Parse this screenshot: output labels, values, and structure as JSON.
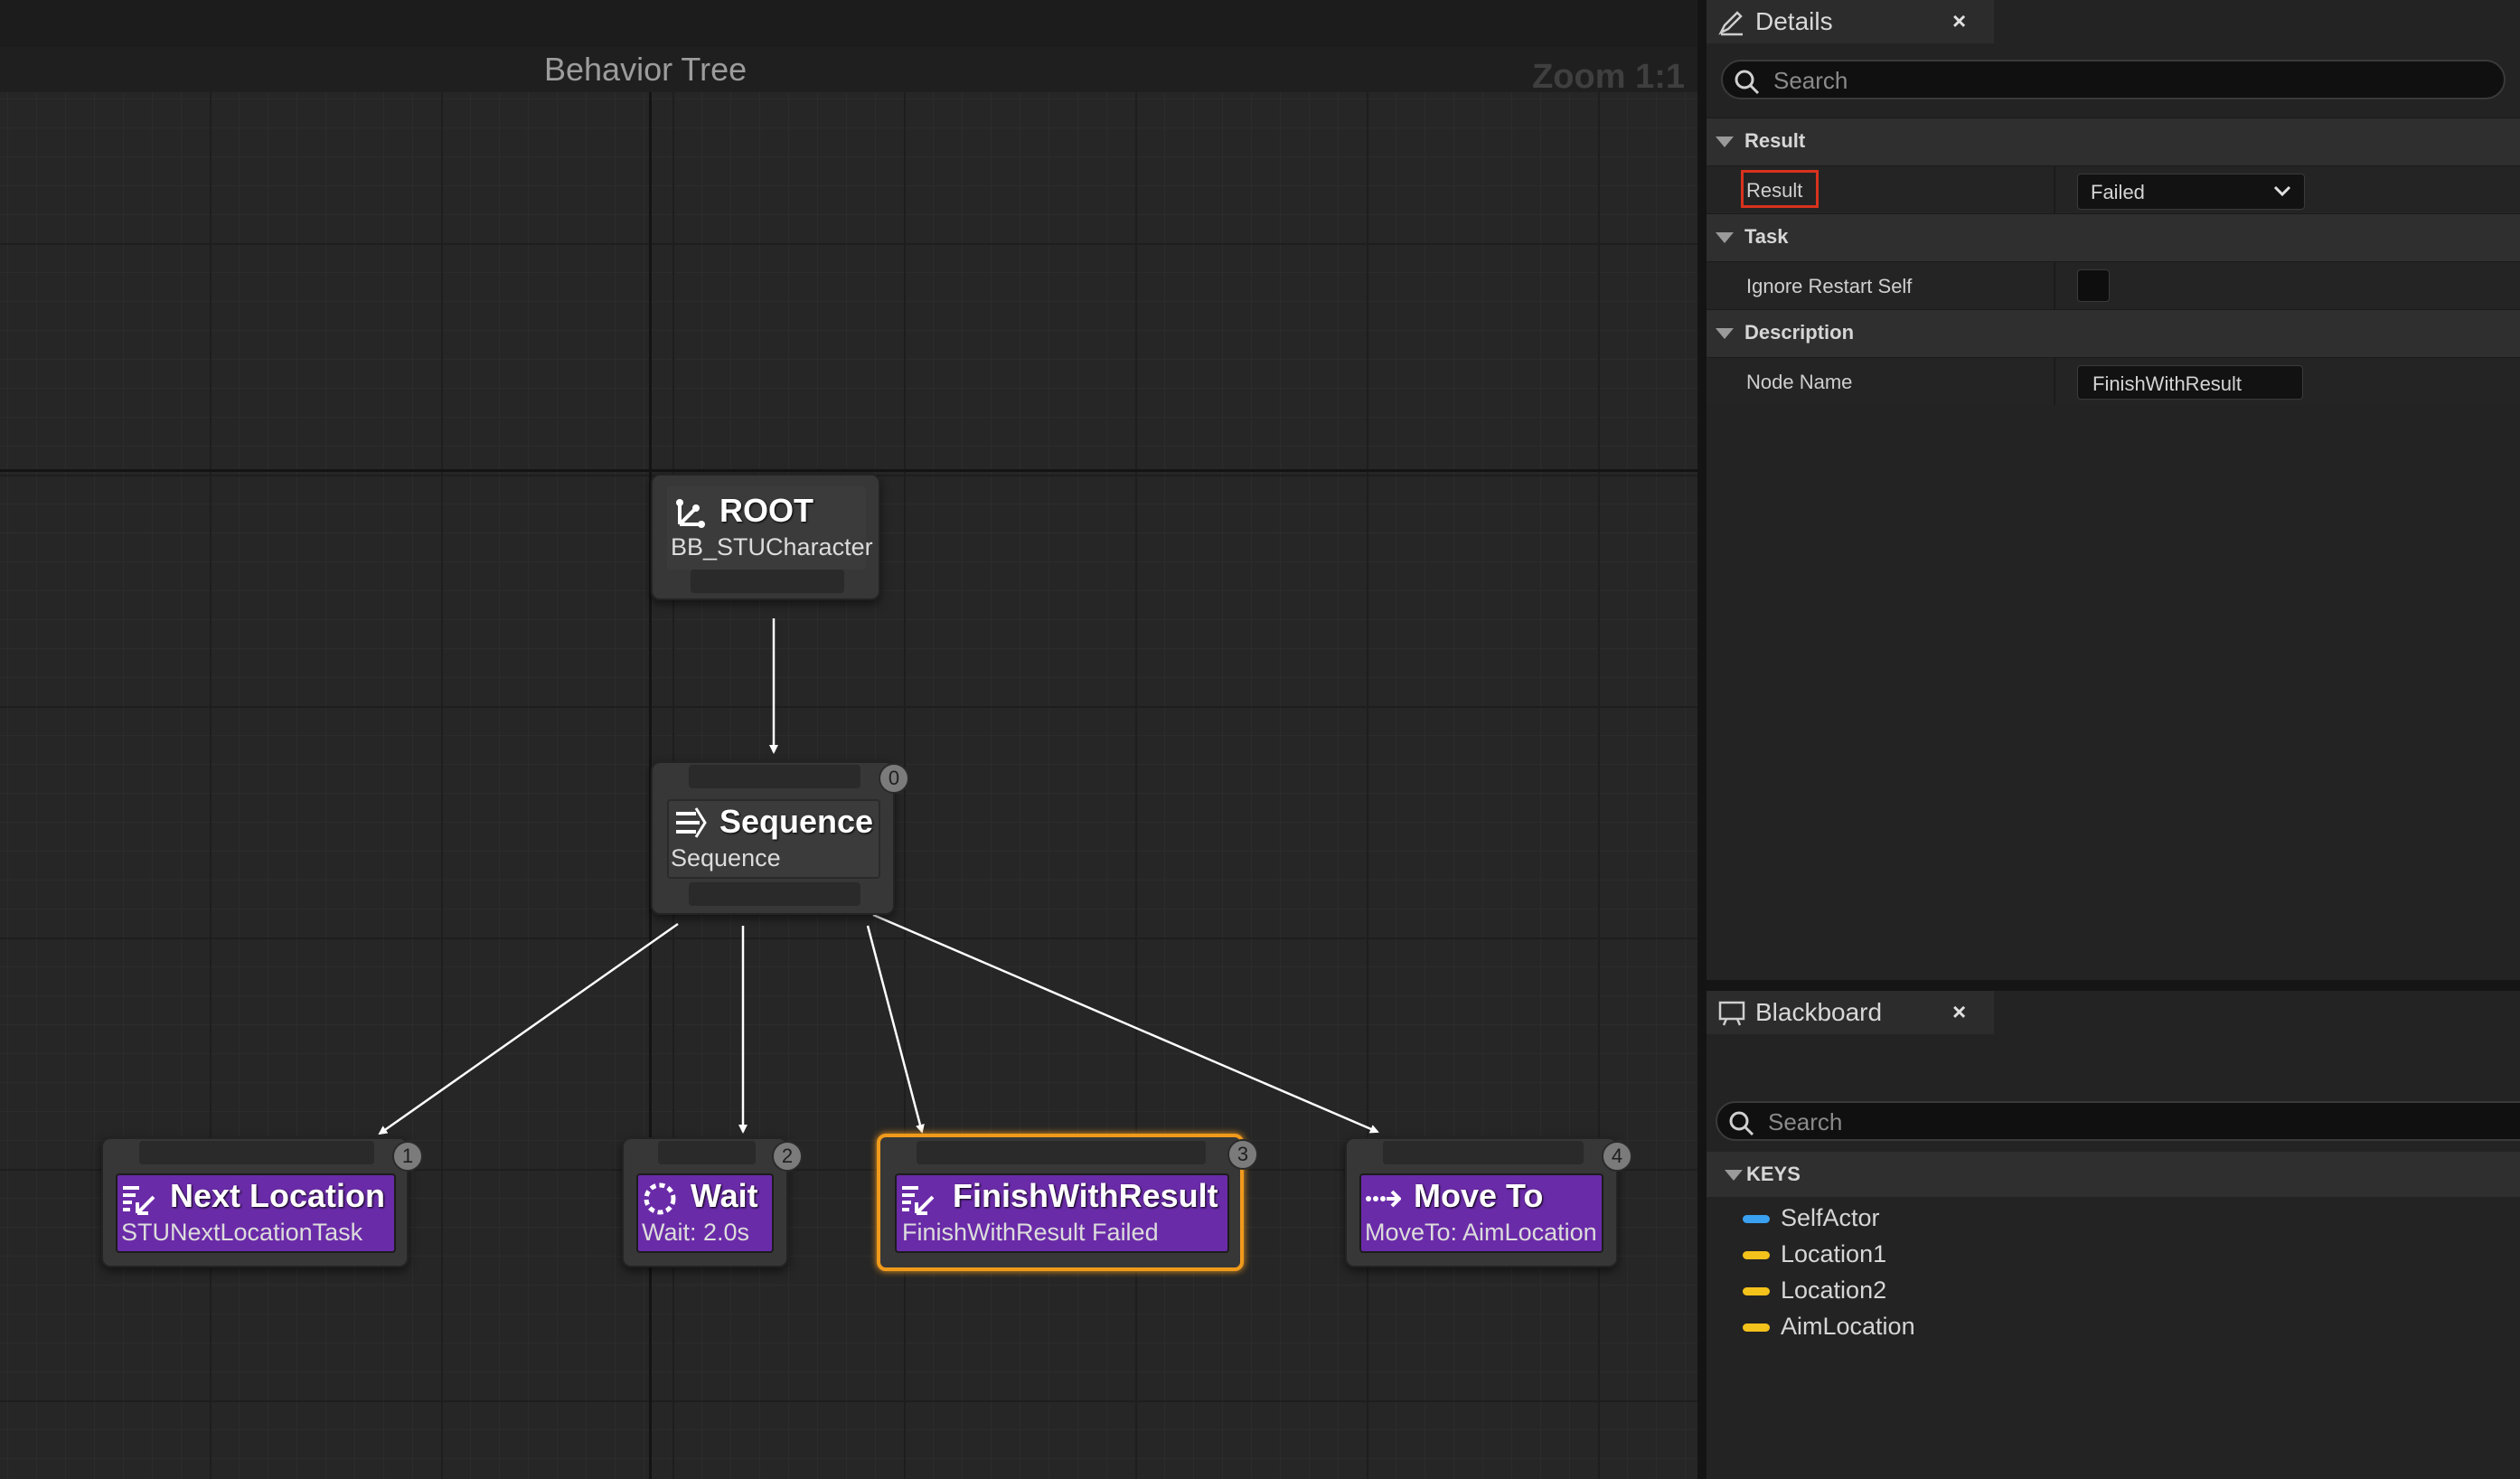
{
  "graph": {
    "title": "Behavior Tree",
    "zoom": "Zoom 1:1",
    "nodes": {
      "root": {
        "title": "ROOT",
        "subtitle": "BB_STUCharacter"
      },
      "sequence": {
        "title": "Sequence",
        "subtitle": "Sequence",
        "index": "0"
      },
      "next_location": {
        "title": "Next Location",
        "subtitle": "STUNextLocationTask",
        "index": "1"
      },
      "wait": {
        "title": "Wait",
        "subtitle": "Wait: 2.0s",
        "index": "2"
      },
      "finish": {
        "title": "FinishWithResult",
        "subtitle": "FinishWithResult Failed",
        "index": "3"
      },
      "move_to": {
        "title": "Move To",
        "subtitle": "MoveTo: AimLocation",
        "index": "4"
      }
    }
  },
  "details": {
    "tab_label": "Details",
    "close": "×",
    "search_placeholder": "Search",
    "categories": {
      "result": "Result",
      "task": "Task",
      "description": "Description"
    },
    "props": {
      "result_label": "Result",
      "result_value": "Failed",
      "ignore_label": "Ignore Restart Self",
      "node_name_label": "Node Name",
      "node_name_value": "FinishWithResult"
    }
  },
  "blackboard": {
    "tab_label": "Blackboard",
    "close": "×",
    "search_placeholder": "Search",
    "keys_header": "KEYS",
    "keys": [
      {
        "name": "SelfActor",
        "color": "#3aa0f0"
      },
      {
        "name": "Location1",
        "color": "#f3c21b"
      },
      {
        "name": "Location2",
        "color": "#f3c21b"
      },
      {
        "name": "AimLocation",
        "color": "#f3c21b"
      }
    ]
  }
}
